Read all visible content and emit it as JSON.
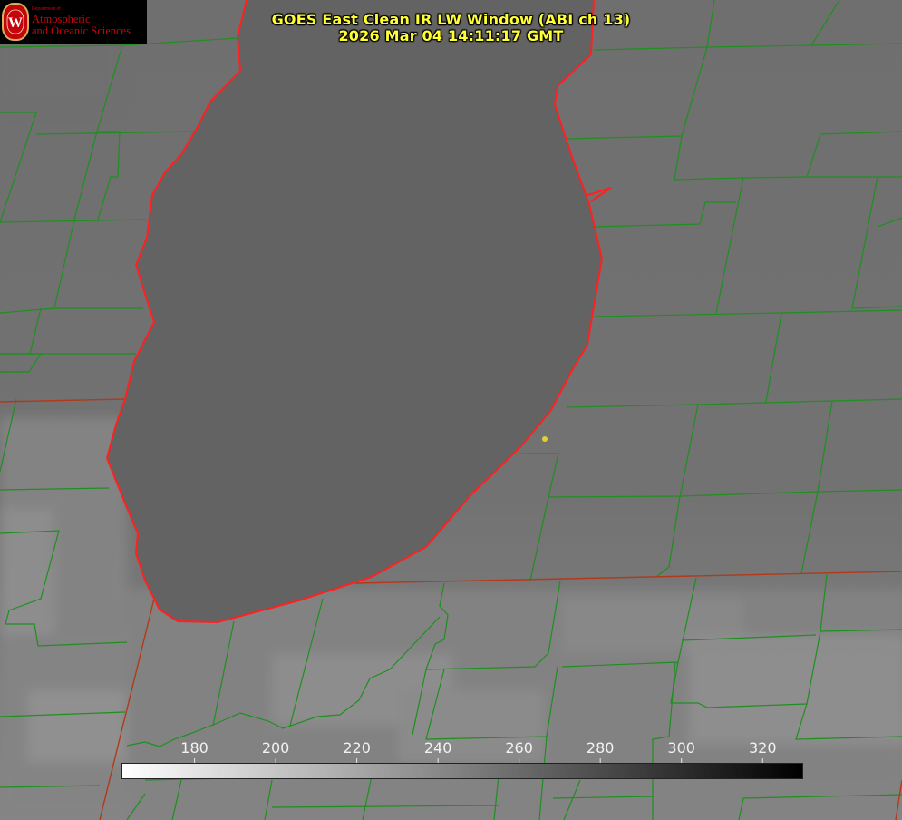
{
  "title_line1": "GOES East Clean IR LW Window (ABI ch 13)",
  "title_line2": "2026 Mar 04 14:11:17 GMT",
  "logo": {
    "department": "Department of",
    "line1": "Atmospheric",
    "line2": "and Oceanic Sciences",
    "seal_letter": "W"
  },
  "colorbar": {
    "ticks": [
      {
        "label": "180",
        "value": 180
      },
      {
        "label": "200",
        "value": 200
      },
      {
        "label": "220",
        "value": 220
      },
      {
        "label": "240",
        "value": 240
      },
      {
        "label": "260",
        "value": 260
      },
      {
        "label": "280",
        "value": 280
      },
      {
        "label": "300",
        "value": 300
      },
      {
        "label": "320",
        "value": 320
      }
    ],
    "min": 162,
    "max": 330,
    "color_low": "#ffffff",
    "color_high": "#000000"
  },
  "colors": {
    "lake": "#616161",
    "land": "#6a6a6a",
    "cloud": "#8c8c8c",
    "county_lines": "#1f8f1f",
    "state_lines": "#b23a1a",
    "coastline": "#ff2020",
    "marker": "#e0d030",
    "title_text": "#ffff33",
    "logo_red": "#c5050c"
  }
}
